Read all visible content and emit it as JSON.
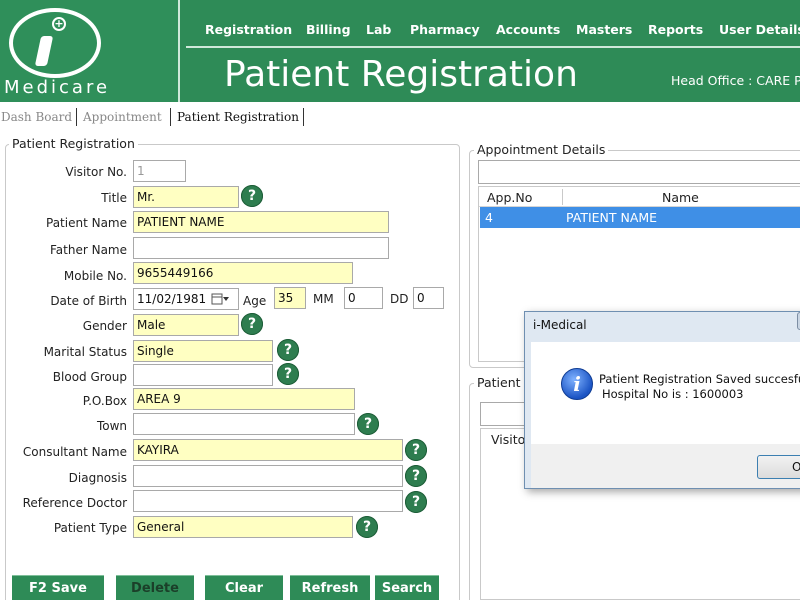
{
  "brand": {
    "logo_text": "Medicare",
    "accent": "#2e8b57"
  },
  "menu": [
    "Registration",
    "Billing",
    "Lab",
    "Pharmacy",
    "Accounts",
    "Masters",
    "Reports",
    "User Details"
  ],
  "page_title": "Patient Registration",
  "head_office": "Head Office :  CARE P",
  "tabs": [
    "Dash Board",
    "Appointment",
    "Patient Registration"
  ],
  "registration": {
    "legend": "Patient Registration",
    "visitor_no": {
      "label": "Visitor No.",
      "value": "1"
    },
    "title": {
      "label": "Title",
      "value": "Mr."
    },
    "patient_name": {
      "label": "Patient Name",
      "value": "PATIENT NAME"
    },
    "father_name": {
      "label": "Father Name",
      "value": ""
    },
    "mobile_no": {
      "label": "Mobile No.",
      "value": "9655449166"
    },
    "dob": {
      "label": "Date of Birth",
      "value": "11/02/1981",
      "age_label": "Age",
      "age": "35",
      "mm_label": "MM",
      "mm": "0",
      "dd_label": "DD",
      "dd": "0"
    },
    "gender": {
      "label": "Gender",
      "value": "Male"
    },
    "marital_status": {
      "label": "Marital Status",
      "value": "Single"
    },
    "blood_group": {
      "label": "Blood Group",
      "value": ""
    },
    "po_box": {
      "label": "P.O.Box",
      "value": "AREA 9"
    },
    "town": {
      "label": "Town",
      "value": ""
    },
    "consultant_name": {
      "label": "Consultant Name",
      "value": "KAYIRA"
    },
    "diagnosis": {
      "label": "Diagnosis",
      "value": ""
    },
    "reference_doctor": {
      "label": "Reference Doctor",
      "value": ""
    },
    "patient_type": {
      "label": "Patient Type",
      "value": "General"
    },
    "help_glyph": "?"
  },
  "buttons": {
    "save": "F2  Save",
    "delete": "Delete",
    "clear": "Clear",
    "refresh": "Refresh",
    "search": "Search"
  },
  "appointment": {
    "legend": "Appointment Details",
    "columns": [
      "App.No",
      "Name"
    ],
    "rows": [
      {
        "app_no": "4",
        "name": "PATIENT NAME"
      }
    ]
  },
  "patient_panel": {
    "legend": "Patient",
    "column": "Visito"
  },
  "dialog": {
    "title": "i-Medical",
    "line1": "Patient Registration Saved succesfully",
    "line2": "Hospital No is : 1600003",
    "ok": "OK",
    "icon": "info-icon"
  }
}
